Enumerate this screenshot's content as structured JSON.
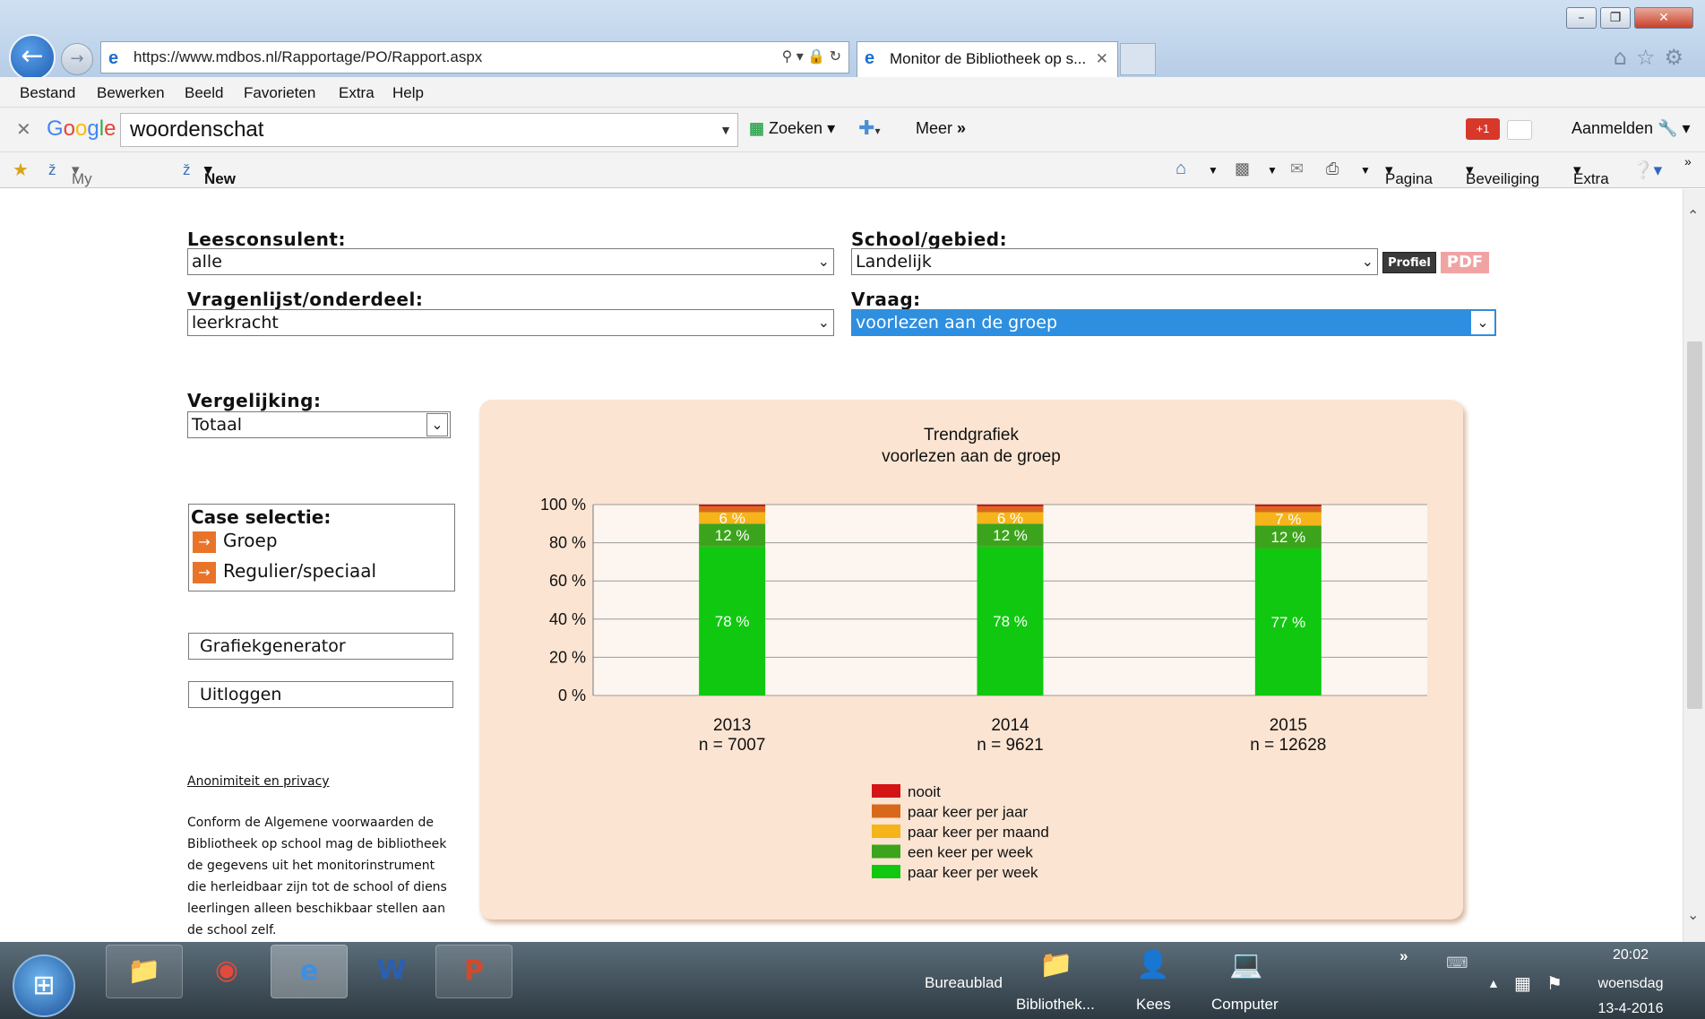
{
  "browser": {
    "url": "https://www.mdbos.nl/Rapportage/PO/Rapport.aspx",
    "tab_title": "Monitor de Bibliotheek op s...",
    "menu": [
      "Bestand",
      "Bewerken",
      "Beeld",
      "Favorieten",
      "Extra",
      "Help"
    ],
    "google_toolbar": {
      "logo": "Google",
      "search_value": "woordenschat",
      "search_button": "Zoeken",
      "more": "Meer",
      "more_icon": "»",
      "plus_one": "+1",
      "signin": "Aanmelden"
    },
    "favorites_bar": {
      "my_library": "My Library",
      "new_issues": "New Issues",
      "pagina": "Pagina",
      "beveiliging": "Beveiliging",
      "extra": "Extra"
    }
  },
  "form": {
    "leesconsulent_label": "Leesconsulent:",
    "leesconsulent_value": "alle",
    "school_label": "School/gebied:",
    "school_value": "Landelijk",
    "profiel_button": "Profiel",
    "pdf_button": "PDF",
    "vragenlijst_label": "Vragenlijst/onderdeel:",
    "vragenlijst_value": "leerkracht",
    "vraag_label": "Vraag:",
    "vraag_value": "voorlezen aan de groep",
    "vergelijking_label": "Vergelijking:",
    "vergelijking_value": "Totaal"
  },
  "sidebar": {
    "case_title": "Case selectie:",
    "case_items": [
      "Groep",
      "Regulier/speciaal"
    ],
    "grafiekgenerator": "Grafiekgenerator",
    "uitloggen": "Uitloggen",
    "privacy_link": "Anonimiteit en privacy",
    "privacy_text": "Conform de Algemene voorwaarden de Bibliotheek op school mag de bibliotheek de gegevens uit het monitorinstrument die herleidbaar zijn tot de school of diens leerlingen alleen beschikbaar stellen aan de school zelf."
  },
  "chart_data": {
    "type": "bar",
    "stacked": true,
    "title": "Trendgrafiek",
    "subtitle": "voorlezen aan de groep",
    "categories": [
      "2013",
      "2014",
      "2015"
    ],
    "n_labels": [
      "n = 7007",
      "n = 9621",
      "n = 12628"
    ],
    "ylim": [
      0,
      100
    ],
    "yticks": [
      "0 %",
      "20 %",
      "40 %",
      "60 %",
      "80 %",
      "100 %"
    ],
    "grid": true,
    "legend_position": "bottom",
    "series": [
      {
        "name": "paar keer per week",
        "color": "#10c810",
        "values": [
          78,
          78,
          77
        ],
        "labels": [
          "78 %",
          "78 %",
          "77 %"
        ]
      },
      {
        "name": "een keer per week",
        "color": "#3ca41c",
        "values": [
          12,
          12,
          12
        ],
        "labels": [
          "12 %",
          "12 %",
          "12 %"
        ]
      },
      {
        "name": "paar keer per maand",
        "color": "#f4b41a",
        "values": [
          6,
          6,
          7
        ],
        "labels": [
          "6 %",
          "6 %",
          "7 %"
        ]
      },
      {
        "name": "paar keer per jaar",
        "color": "#d8691c",
        "values": [
          3,
          3,
          3
        ],
        "labels": [
          "",
          "",
          ""
        ]
      },
      {
        "name": "nooit",
        "color": "#d41414",
        "values": [
          1,
          1,
          1
        ],
        "labels": [
          "",
          "",
          ""
        ]
      }
    ],
    "legend_order": [
      "nooit",
      "paar keer per jaar",
      "paar keer per maand",
      "een keer per week",
      "paar keer per week"
    ]
  },
  "taskbar": {
    "bureaublad": "Bureaublad",
    "toolbar_items": [
      "Bibliothek...",
      "Kees",
      "Computer"
    ],
    "expand_icon": "»",
    "time": "20:02",
    "day": "woensdag",
    "date": "13-4-2016"
  }
}
